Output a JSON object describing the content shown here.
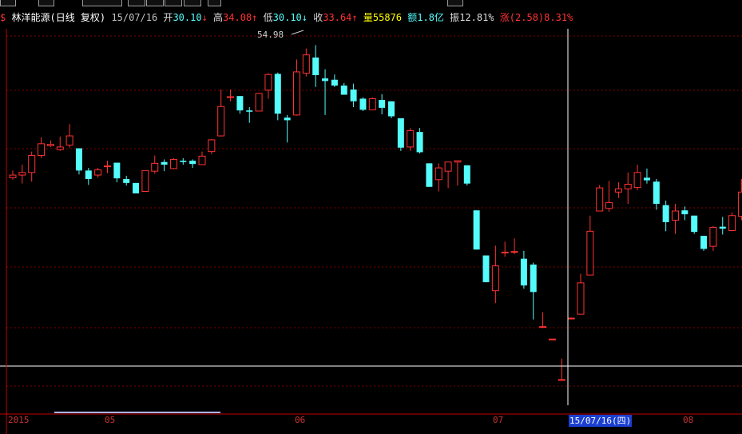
{
  "header": {
    "stock_icon": "$",
    "name": "林洋能源(日线 复权)",
    "date": "15/07/16",
    "open_label": "开",
    "open": "30.10",
    "open_arrow": "↓",
    "high_label": "高",
    "high": "34.08",
    "high_arrow": "↑",
    "low_label": "低",
    "low": "30.10",
    "low_arrow": "↓",
    "close_label": "收",
    "close": "33.64",
    "close_arrow": "↑",
    "volume_label": "量",
    "volume": "55876",
    "amount_label": "额",
    "amount": "1.8亿",
    "amplitude_label": "振",
    "amplitude": "12.81%",
    "change_label": "涨",
    "change": "(2.58)",
    "change_pct": "8.31%"
  },
  "annotation": {
    "high_mark": "54.98"
  },
  "xaxis": {
    "ticks": [
      "2015",
      "05",
      "06",
      "07",
      "08"
    ],
    "selected": "15/07/16(四)"
  },
  "colors": {
    "up": "#ff3232",
    "down": "#54fcfc",
    "grid": "#800000",
    "text": "#c0c0c0"
  },
  "chart_data": {
    "type": "candlestick",
    "series_order": "open,close,high,low",
    "candles": [
      [
        35.2,
        35.6,
        36.3,
        34.9
      ],
      [
        35.6,
        36.0,
        37.2,
        34.3
      ],
      [
        36.0,
        38.6,
        39.2,
        34.6
      ],
      [
        38.6,
        40.4,
        41.4,
        38.2
      ],
      [
        40.1,
        40.3,
        40.9,
        39.9
      ],
      [
        39.5,
        39.9,
        41.5,
        39.3
      ],
      [
        40.2,
        41.6,
        43.4,
        39.8
      ],
      [
        39.7,
        36.3,
        39.7,
        35.7
      ],
      [
        36.3,
        35.0,
        36.7,
        34.1
      ],
      [
        35.6,
        36.4,
        36.7,
        35.2
      ],
      [
        36.9,
        37.0,
        37.8,
        35.9
      ],
      [
        37.5,
        35.1,
        37.5,
        34.5
      ],
      [
        35.0,
        34.4,
        35.5,
        34.0
      ],
      [
        34.4,
        32.8,
        34.4,
        32.8
      ],
      [
        33.1,
        36.3,
        36.3,
        33.1
      ],
      [
        36.2,
        37.4,
        38.6,
        35.8
      ],
      [
        37.6,
        37.2,
        38.0,
        36.2
      ],
      [
        36.6,
        38.0,
        38.2,
        36.5
      ],
      [
        37.8,
        37.6,
        38.2,
        37.2
      ],
      [
        37.8,
        37.3,
        38.0,
        36.7
      ],
      [
        37.2,
        38.5,
        39.2,
        37.2
      ],
      [
        39.2,
        41.0,
        41.1,
        38.8
      ],
      [
        41.6,
        46.1,
        48.7,
        41.5
      ],
      [
        47.5,
        47.6,
        48.7,
        46.9
      ],
      [
        47.7,
        45.5,
        47.7,
        45.0
      ],
      [
        45.5,
        45.3,
        46.0,
        43.6
      ],
      [
        45.4,
        48.1,
        48.2,
        45.4
      ],
      [
        48.6,
        51.0,
        51.2,
        47.3
      ],
      [
        51.1,
        45.0,
        51.3,
        44.0
      ],
      [
        44.4,
        44.0,
        44.8,
        40.6
      ],
      [
        44.8,
        51.4,
        53.3,
        44.7
      ],
      [
        51.2,
        54.0,
        54.98,
        50.7
      ],
      [
        53.6,
        50.9,
        55.5,
        49.1
      ],
      [
        50.4,
        50.0,
        51.8,
        44.8
      ],
      [
        50.2,
        49.3,
        51.0,
        49.1
      ],
      [
        49.3,
        47.9,
        49.7,
        48.2
      ],
      [
        48.7,
        46.9,
        49.6,
        46.0
      ],
      [
        47.3,
        45.6,
        47.5,
        45.4
      ],
      [
        45.6,
        47.3,
        47.5,
        45.6
      ],
      [
        47.1,
        45.9,
        48.0,
        44.9
      ],
      [
        46.9,
        44.6,
        46.9,
        44.3
      ],
      [
        44.3,
        39.8,
        44.3,
        39.3
      ],
      [
        39.9,
        42.4,
        42.8,
        39.3
      ],
      [
        42.2,
        39.1,
        42.8,
        38.9
      ],
      [
        37.4,
        33.8,
        37.4,
        33.8
      ],
      [
        34.9,
        36.7,
        37.4,
        33.1
      ],
      [
        36.2,
        37.6,
        37.6,
        33.6
      ],
      [
        37.6,
        37.8,
        37.8,
        34.0
      ],
      [
        37.1,
        34.3,
        37.1,
        34.0
      ],
      [
        30.2,
        24.2,
        30.2,
        24.2
      ],
      [
        23.3,
        19.2,
        23.3,
        19.2
      ],
      [
        17.9,
        21.7,
        24.8,
        16.0
      ],
      [
        23.8,
        23.8,
        25.4,
        23.1
      ],
      [
        23.8,
        23.9,
        25.9,
        23.5
      ],
      [
        22.8,
        18.7,
        24.0,
        18.2
      ],
      [
        21.9,
        17.7,
        22.2,
        13.5
      ],
      [
        12.4,
        12.4,
        14.6,
        12.2
      ],
      [
        10.5,
        10.5,
        10.5,
        10.5
      ],
      [
        4.3,
        4.3,
        7.5,
        4.2
      ],
      [
        13.7,
        13.7,
        13.8,
        13.7
      ],
      [
        14.3,
        19.1,
        20.5,
        14.3
      ],
      [
        20.3,
        27.0,
        29.4,
        20.3
      ],
      [
        30.1,
        33.64,
        34.08,
        30.1
      ],
      [
        30.5,
        31.4,
        34.7,
        30.0
      ],
      [
        33.0,
        33.5,
        34.5,
        32.1
      ],
      [
        33.5,
        34.2,
        36.0,
        31.2
      ],
      [
        33.7,
        36.0,
        37.2,
        33.3
      ],
      [
        35.2,
        34.8,
        36.6,
        34.3
      ],
      [
        34.6,
        31.2,
        35.0,
        30.3
      ],
      [
        31.0,
        28.4,
        31.7,
        27.0
      ],
      [
        28.7,
        30.1,
        31.2,
        26.6
      ],
      [
        30.2,
        29.6,
        30.8,
        28.7
      ],
      [
        29.4,
        26.9,
        29.4,
        26.6
      ],
      [
        26.3,
        24.3,
        26.3,
        24.0
      ],
      [
        24.7,
        27.6,
        27.8,
        24.0
      ],
      [
        27.7,
        27.4,
        29.2,
        26.5
      ],
      [
        27.1,
        29.4,
        29.9,
        27.0
      ],
      [
        29.3,
        33.0,
        35.0,
        28.7
      ],
      [
        33.1,
        32.9,
        34.7,
        32.1
      ],
      [
        32.5,
        32.4,
        32.6,
        32.0
      ]
    ]
  }
}
